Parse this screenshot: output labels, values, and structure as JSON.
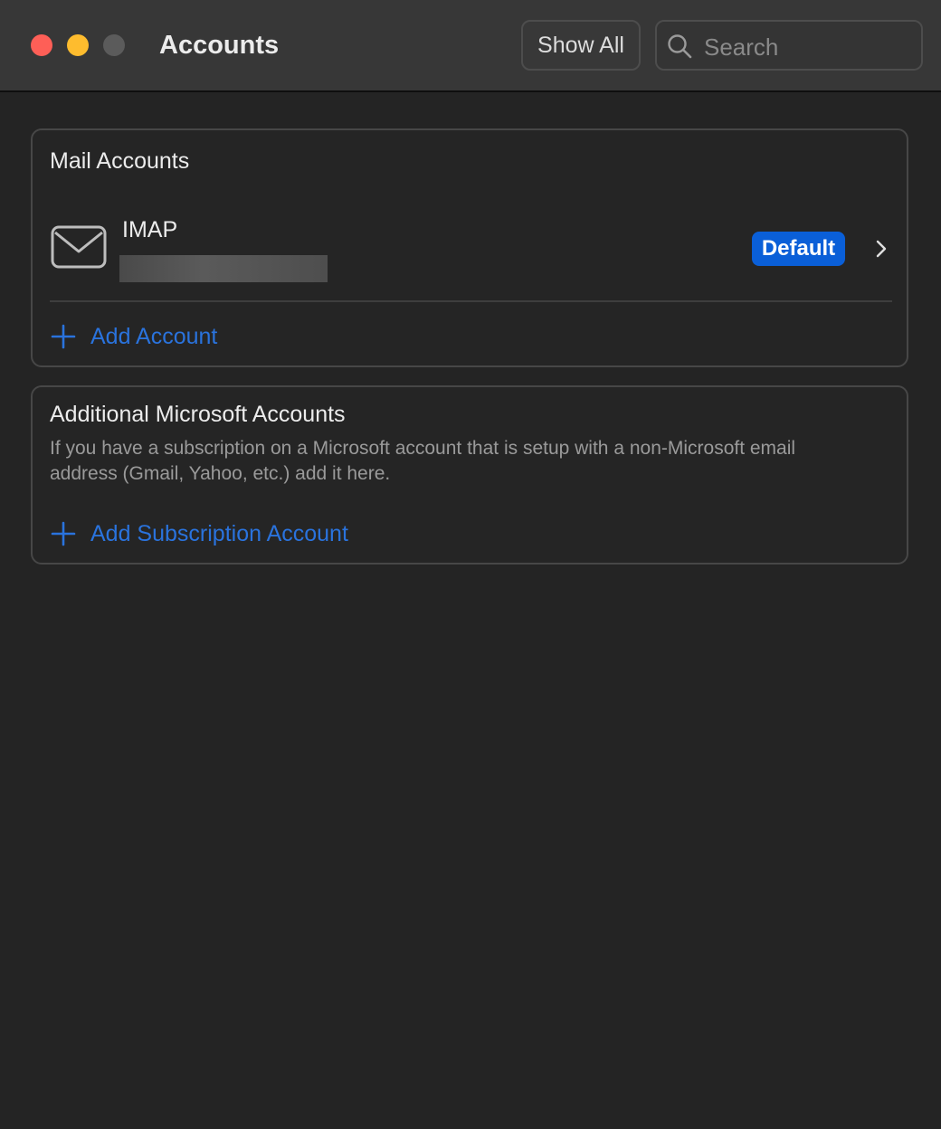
{
  "window": {
    "title": "Accounts",
    "show_all_label": "Show All",
    "search_placeholder": "Search"
  },
  "mail_accounts": {
    "heading": "Mail Accounts",
    "accounts": [
      {
        "type": "IMAP",
        "badge": "Default",
        "icon": "mail-envelope-icon"
      }
    ],
    "add_label": "Add Account"
  },
  "microsoft_accounts": {
    "heading": "Additional Microsoft Accounts",
    "description": "If you have a subscription on a Microsoft account that is setup with a non-Microsoft email address (Gmail, Yahoo, etc.) add it here.",
    "add_label": "Add Subscription Account"
  },
  "colors": {
    "accent": "#0a5fd8",
    "link": "#2a73dd",
    "close": "#fe5f57",
    "minimize": "#febc2e",
    "zoom_disabled": "#5b5b5b"
  }
}
